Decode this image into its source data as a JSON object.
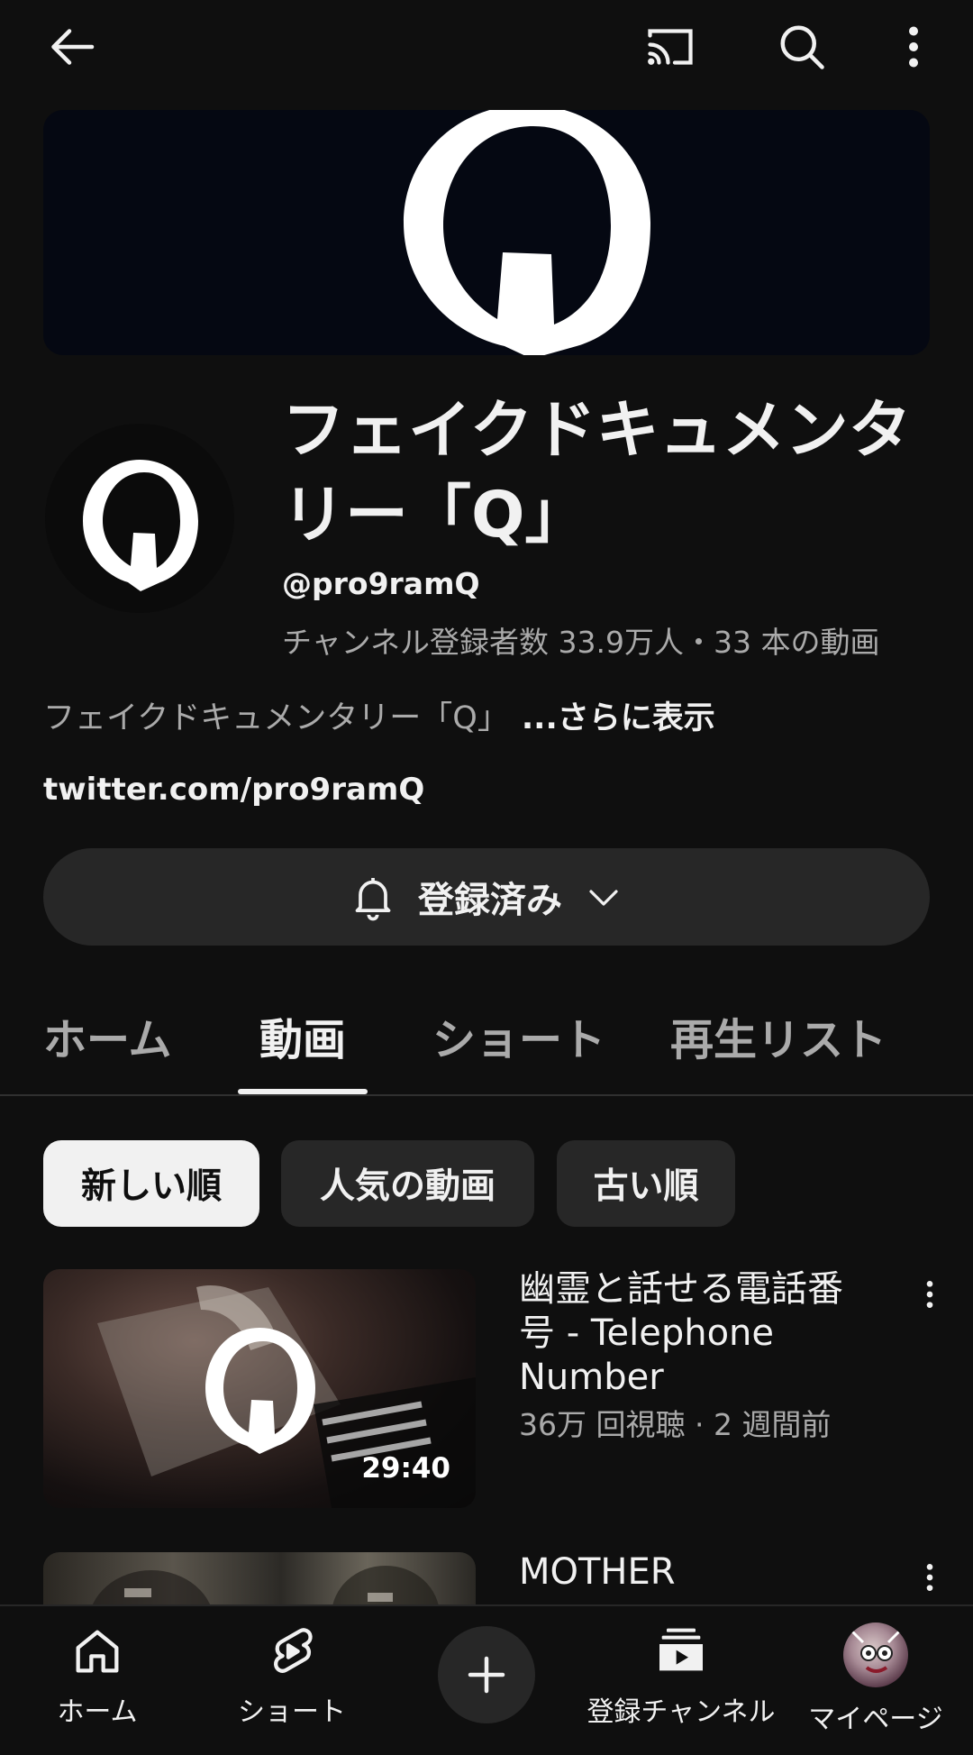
{
  "top_bar": {
    "icons": [
      "back-arrow-icon",
      "cast-icon",
      "search-icon",
      "more-vert-icon"
    ]
  },
  "channel": {
    "name": "フェイクドキュメンタリー「Q」",
    "handle": "@pro9ramQ",
    "stats": "チャンネル登録者数 33.9万人・33 本の動画",
    "description": "フェイクドキュメンタリー「Q」",
    "more_label": "...さらに表示",
    "link": "twitter.com/pro9ramQ",
    "subscribe_label": "登録済み"
  },
  "tabs": [
    {
      "label": "ホーム",
      "active": false
    },
    {
      "label": "動画",
      "active": true
    },
    {
      "label": "ショート",
      "active": false
    },
    {
      "label": "再生リスト",
      "active": false
    }
  ],
  "chips": [
    {
      "label": "新しい順",
      "active": true
    },
    {
      "label": "人気の動画",
      "active": false
    },
    {
      "label": "古い順",
      "active": false
    }
  ],
  "videos": [
    {
      "title": "幽霊と話せる電話番号 - Telephone Number",
      "meta": "36万 回視聴 · 2 週間前",
      "duration": "29:40"
    },
    {
      "title": "MOTHER",
      "meta": "",
      "duration": ""
    }
  ],
  "bottom_nav": [
    {
      "label": "ホーム",
      "icon": "home-icon"
    },
    {
      "label": "ショート",
      "icon": "shorts-icon"
    },
    {
      "label": "",
      "icon": "create-plus-icon"
    },
    {
      "label": "登録チャンネル",
      "icon": "subscriptions-icon"
    },
    {
      "label": "マイページ",
      "icon": "avatar"
    }
  ],
  "colors": {
    "background": "#0f0f0f",
    "surface": "#272727",
    "text_primary": "#f1f1f1",
    "text_secondary": "#aaaaaa"
  }
}
